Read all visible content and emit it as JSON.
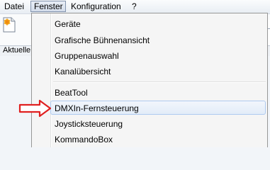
{
  "menubar": {
    "items": [
      {
        "label": "Datei"
      },
      {
        "label": "Fenster"
      },
      {
        "label": "Konfiguration"
      },
      {
        "label": "?"
      }
    ]
  },
  "statusbar": {
    "label": "Aktuelle"
  },
  "fenster_menu": {
    "items": [
      {
        "label": "Geräte"
      },
      {
        "label": "Grafische Bühnenansicht"
      },
      {
        "label": "Gruppenauswahl"
      },
      {
        "label": "Kanalübersicht"
      },
      {
        "label": "BeatTool"
      },
      {
        "label": "DMXIn-Fernsteuerung"
      },
      {
        "label": "Joysticksteuerung"
      },
      {
        "label": "KommandoBox"
      }
    ],
    "highlighted_item": "DMXIn-Fernsteuerung"
  },
  "colors": {
    "arrow": "#e02020",
    "highlight": "#dfe9f7"
  },
  "icons": [
    "new-document-icon",
    "red-arrow-icon"
  ]
}
